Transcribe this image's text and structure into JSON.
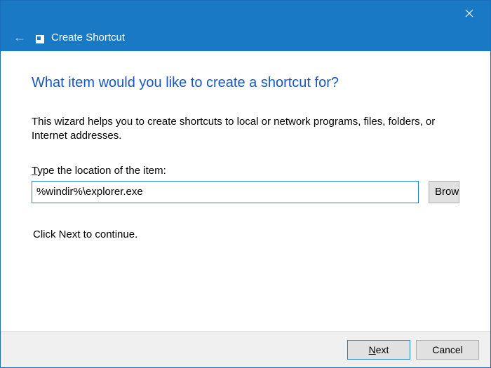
{
  "titlebar": {
    "title": "Create Shortcut"
  },
  "content": {
    "heading": "What item would you like to create a shortcut for?",
    "description": "This wizard helps you to create shortcuts to local or network programs, files, folders, or Internet addresses.",
    "location_label_prefix": "T",
    "location_label_rest": "ype the location of the item:",
    "location_value": "%windir%\\explorer.exe",
    "browse_label": "Browse...",
    "continue_text": "Click Next to continue."
  },
  "buttons": {
    "next_underline": "N",
    "next_rest": "ext",
    "cancel": "Cancel"
  }
}
